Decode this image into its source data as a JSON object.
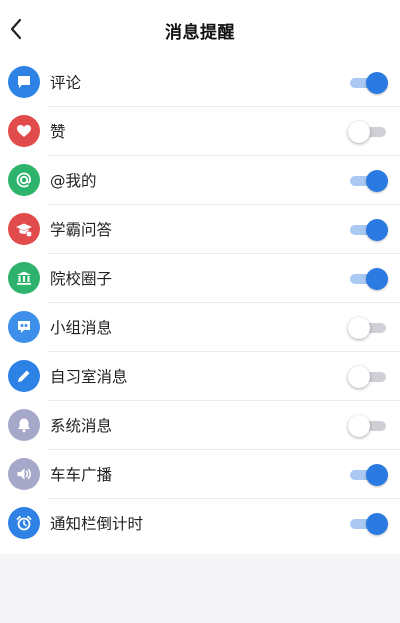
{
  "header": {
    "title": "消息提醒"
  },
  "colors": {
    "accent": "#2A7AE2",
    "toggle_off_track": "#CFCFD6"
  },
  "items": [
    {
      "label": "评论",
      "icon": "comment-icon",
      "color": "#2E82E6",
      "enabled": true
    },
    {
      "label": "赞",
      "icon": "heart-icon",
      "color": "#E24B4B",
      "enabled": false
    },
    {
      "label": "@我的",
      "icon": "at-icon",
      "color": "#2DB36B",
      "enabled": true
    },
    {
      "label": "学霸问答",
      "icon": "graduation-cap-icon",
      "color": "#E24B4B",
      "enabled": true
    },
    {
      "label": "院校圈子",
      "icon": "institution-icon",
      "color": "#2DB36B",
      "enabled": true
    },
    {
      "label": "小组消息",
      "icon": "group-icon",
      "color": "#3D8FEA",
      "enabled": false
    },
    {
      "label": "自习室消息",
      "icon": "pencil-icon",
      "color": "#2E82E6",
      "enabled": false
    },
    {
      "label": "系统消息",
      "icon": "bell-icon",
      "color": "#A5A8C8",
      "enabled": false
    },
    {
      "label": "车车广播",
      "icon": "speaker-icon",
      "color": "#A5A8C8",
      "enabled": true
    },
    {
      "label": "通知栏倒计时",
      "icon": "alarm-clock-icon",
      "color": "#2E82E6",
      "enabled": true
    }
  ]
}
